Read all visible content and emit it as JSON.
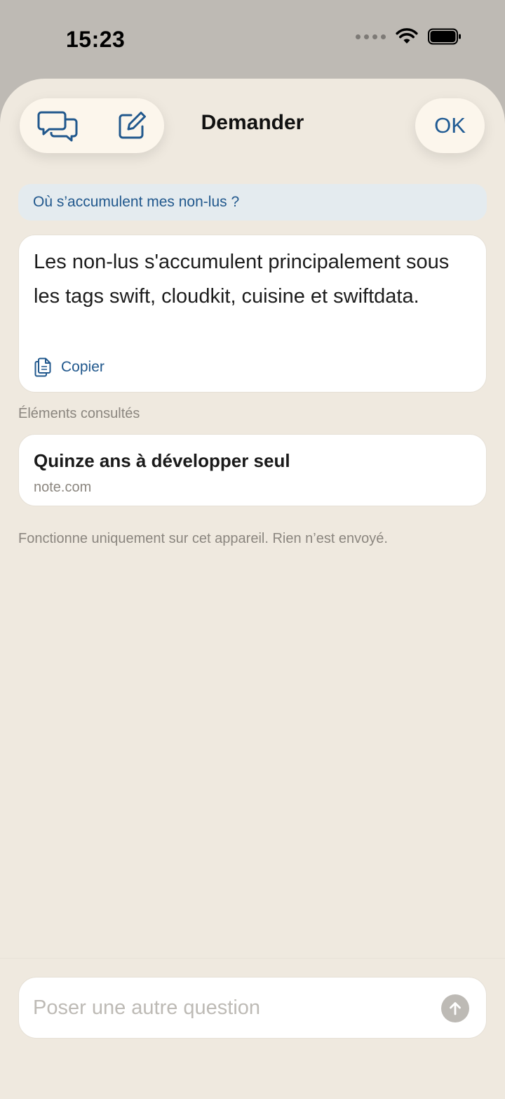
{
  "status_bar": {
    "time": "15:23"
  },
  "nav": {
    "title": "Demander",
    "ok_label": "OK",
    "left_icons": [
      "chat-bubbles-icon",
      "compose-icon"
    ]
  },
  "conversation": {
    "question": "Où s’accumulent mes non-lus ?",
    "answer": "Les non-lus s'accumulent principalement sous les tags swift, cloudkit, cuisine et swiftdata.",
    "copy_label": "Copier"
  },
  "sources": {
    "label": "Éléments consultés",
    "items": [
      {
        "title": "Quinze ans à développer seul",
        "domain": "note.com"
      }
    ]
  },
  "footer_note": "Fonctionne uniquement sur cet appareil. Rien n’est envoyé.",
  "input": {
    "placeholder": "Poser une autre question",
    "value": ""
  },
  "colors": {
    "accent": "#21588d",
    "background": "#efe9df",
    "card": "#ffffff",
    "question_bg": "#e4ebef",
    "muted_text": "#8b867f"
  }
}
